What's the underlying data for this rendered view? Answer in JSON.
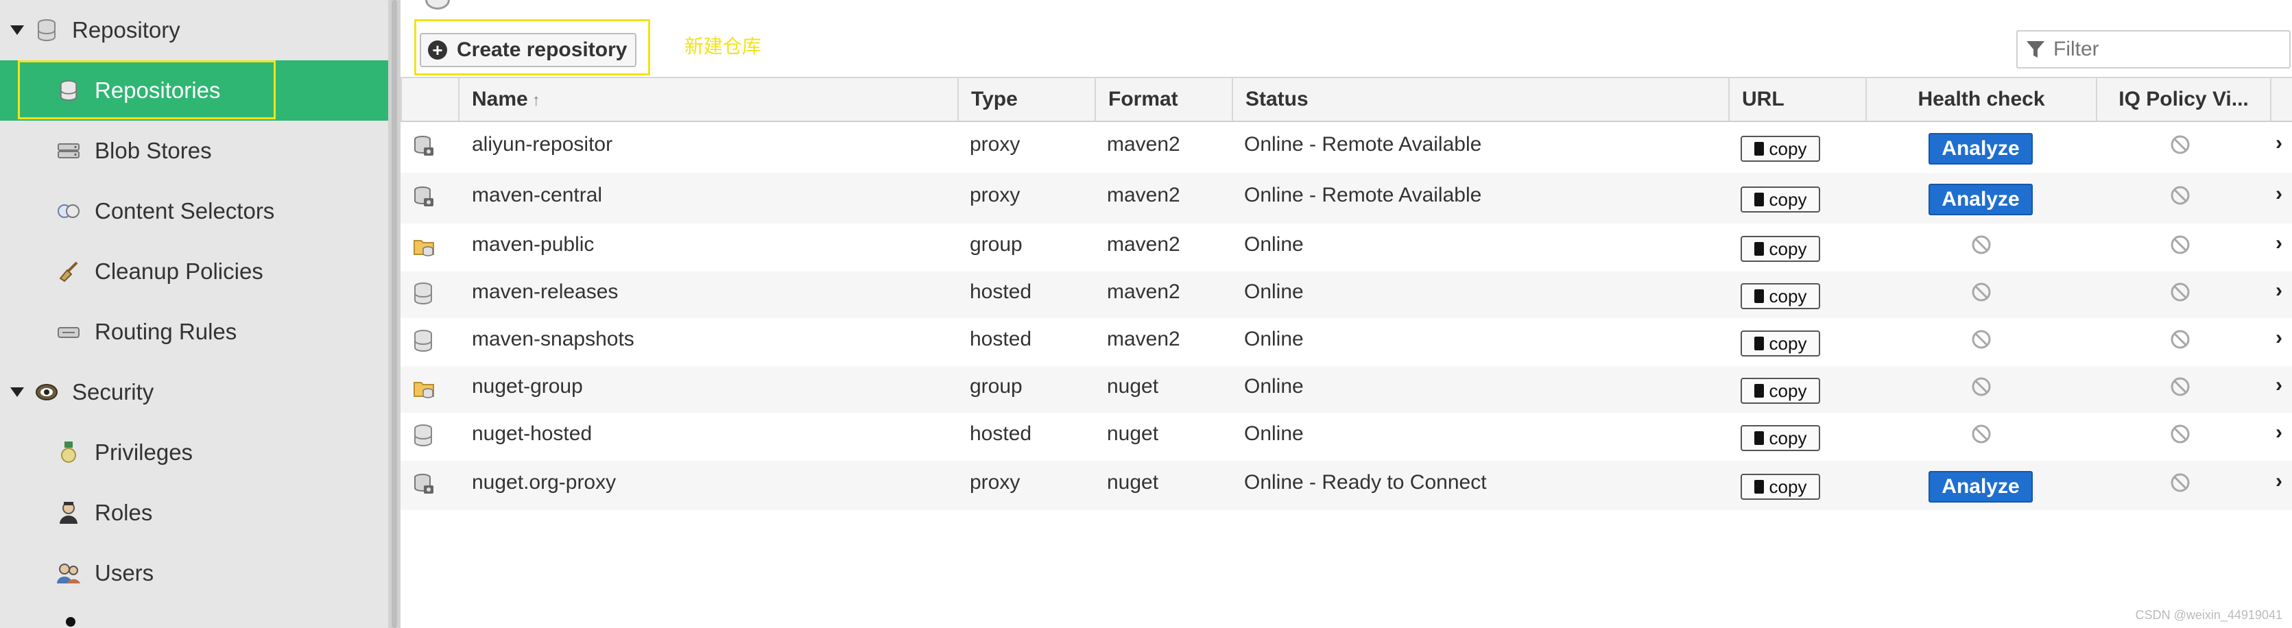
{
  "sidebar": {
    "groups": [
      {
        "label": "Repository",
        "icon": "database-icon"
      },
      {
        "label": "Security",
        "icon": "eye-badge-icon"
      }
    ],
    "items": [
      {
        "label": "Repositories",
        "icon": "database-icon",
        "active": true
      },
      {
        "label": "Blob Stores",
        "icon": "server-icon"
      },
      {
        "label": "Content Selectors",
        "icon": "selector-icon"
      },
      {
        "label": "Cleanup Policies",
        "icon": "broom-icon"
      },
      {
        "label": "Routing Rules",
        "icon": "router-icon"
      },
      {
        "label": "Privileges",
        "icon": "medal-icon"
      },
      {
        "label": "Roles",
        "icon": "user-role-icon"
      },
      {
        "label": "Users",
        "icon": "users-icon"
      }
    ]
  },
  "toolbar": {
    "create_label": "Create repository",
    "annotation": "新建仓库",
    "filter_placeholder": "Filter"
  },
  "table": {
    "columns": [
      "Name",
      "Type",
      "Format",
      "Status",
      "URL",
      "Health check",
      "IQ Policy Vi..."
    ],
    "copy_label": "copy",
    "analyze_label": "Analyze",
    "rows": [
      {
        "name": "aliyun-repositor",
        "type": "proxy",
        "format": "maven2",
        "status": "Online - Remote Available",
        "analyze": true
      },
      {
        "name": "maven-central",
        "type": "proxy",
        "format": "maven2",
        "status": "Online - Remote Available",
        "analyze": true
      },
      {
        "name": "maven-public",
        "type": "group",
        "format": "maven2",
        "status": "Online",
        "analyze": false
      },
      {
        "name": "maven-releases",
        "type": "hosted",
        "format": "maven2",
        "status": "Online",
        "analyze": false
      },
      {
        "name": "maven-snapshots",
        "type": "hosted",
        "format": "maven2",
        "status": "Online",
        "analyze": false
      },
      {
        "name": "nuget-group",
        "type": "group",
        "format": "nuget",
        "status": "Online",
        "analyze": false
      },
      {
        "name": "nuget-hosted",
        "type": "hosted",
        "format": "nuget",
        "status": "Online",
        "analyze": false
      },
      {
        "name": "nuget.org-proxy",
        "type": "proxy",
        "format": "nuget",
        "status": "Online - Ready to Connect",
        "analyze": true
      }
    ]
  },
  "watermark": "CSDN @weixin_44919041",
  "colors": {
    "accent": "#2fb673",
    "highlight": "#f2e318",
    "analyze": "#1f6fd0"
  }
}
